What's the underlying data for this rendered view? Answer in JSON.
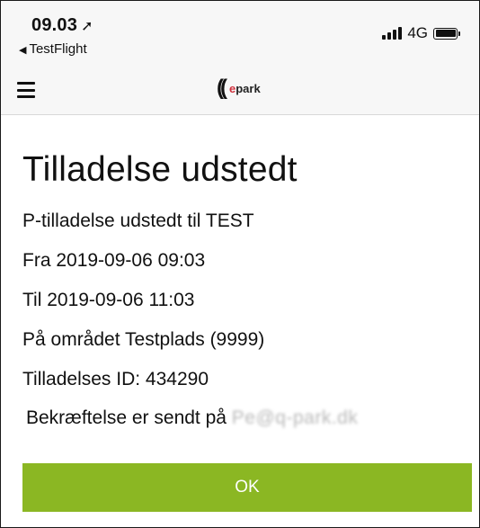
{
  "status_bar": {
    "time": "09.03",
    "location_glyph": "➚",
    "back_app": "TestFlight",
    "network": "4G",
    "signal_icon": "signal-bars-icon",
    "battery_icon": "battery-icon"
  },
  "app_bar": {
    "menu_icon": "hamburger-menu-icon",
    "logo": {
      "brackets": "((",
      "e": "e",
      "word": "park"
    }
  },
  "page": {
    "title": "Tilladelse udstedt",
    "issued_to": "P-tilladelse udstedt til TEST",
    "from": "Fra 2019-09-06 09:03",
    "to": "Til 2019-09-06 11:03",
    "area": "På området Testplads (9999)",
    "permit_id": "Tilladelses ID: 434290",
    "confirmation_prefix": "Bekræftelse er sendt på",
    "confirmation_email": "Pe@q-park.dk"
  },
  "actions": {
    "ok_label": "OK"
  },
  "colors": {
    "accent": "#8bb723",
    "logo_e": "#d0303c",
    "bar_bg": "#f7f7f7"
  }
}
